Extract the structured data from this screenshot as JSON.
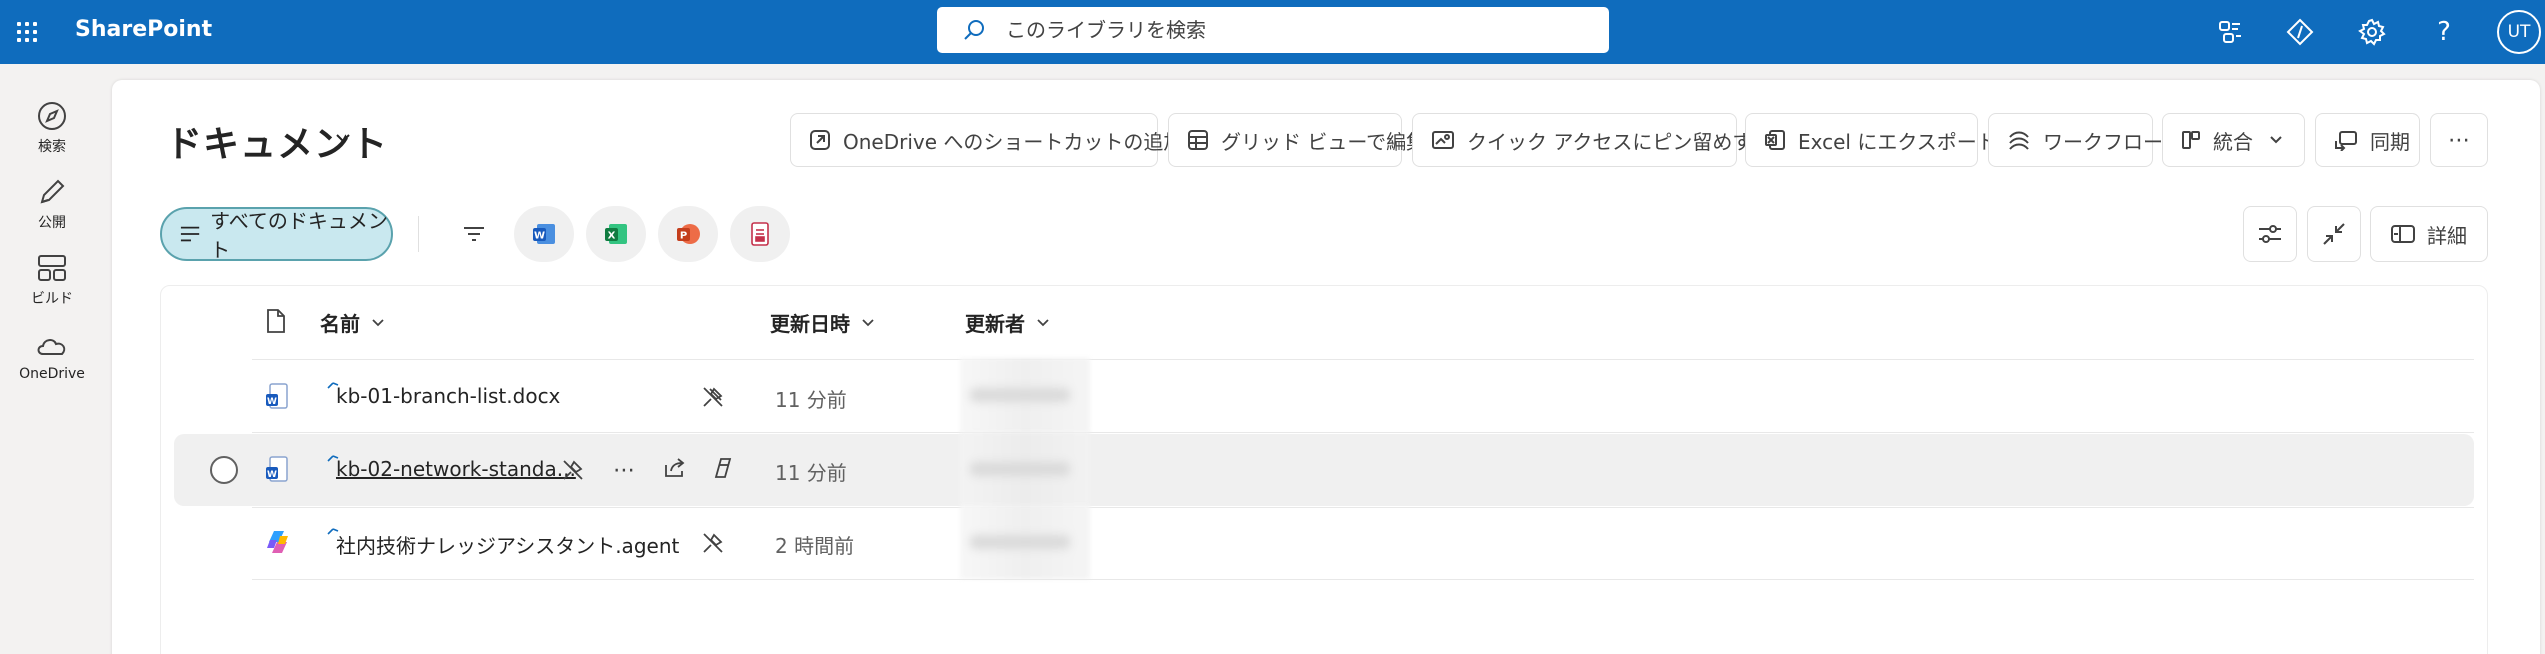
{
  "app": {
    "title": "SharePoint"
  },
  "search": {
    "placeholder": "このライブラリを検索"
  },
  "user": {
    "initials": "UT"
  },
  "rail": [
    {
      "label": "検索"
    },
    {
      "label": "公開"
    },
    {
      "label": "ビルド"
    },
    {
      "label": "OneDrive"
    }
  ],
  "library": {
    "title": "ドキュメント"
  },
  "commands": {
    "shortcut": "OneDrive へのショートカットの追加",
    "grid": "グリッド ビューで編集",
    "pin": "クイック アクセスにピン留めする",
    "excel": "Excel にエクスポート",
    "workflow": "ワークフロー",
    "integrate": "統合",
    "sync": "同期"
  },
  "view": {
    "label": "すべてのドキュメント"
  },
  "details": {
    "label": "詳細"
  },
  "columns": {
    "name": "名前",
    "modified": "更新日時",
    "modified_by": "更新者"
  },
  "files": [
    {
      "name": "kb-01-branch-list.docx",
      "modified": "11 分前",
      "icon": "word-icon"
    },
    {
      "name": "kb-02-network-standa...",
      "modified": "11 分前",
      "icon": "word-icon"
    },
    {
      "name": "社内技術ナレッジアシスタント.agent",
      "modified": "2 時間前",
      "icon": "copilot-agent-icon"
    }
  ],
  "colors": {
    "topbar": "#0f6cbd",
    "view_pill": "#c9e8ef",
    "word": "#185abd",
    "excel": "#107c41",
    "powerpoint": "#c43e1c"
  }
}
